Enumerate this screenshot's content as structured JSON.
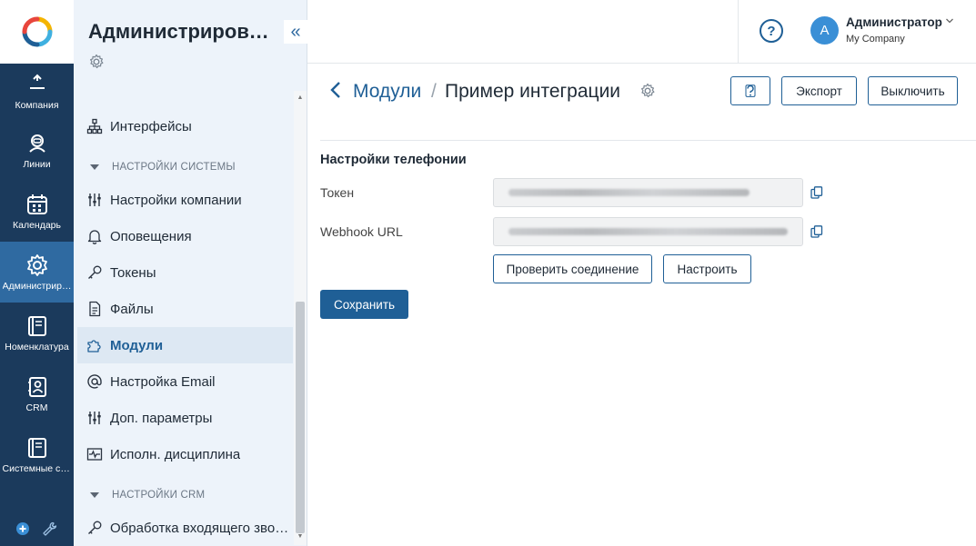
{
  "rail": {
    "items": [
      {
        "label": "Компания",
        "icon": "company-icon"
      },
      {
        "label": "Линии",
        "icon": "lines-icon"
      },
      {
        "label": "Календарь",
        "icon": "calendar-icon"
      },
      {
        "label": "Администрирование",
        "icon": "gear-icon",
        "active": true
      },
      {
        "label": "Номенклатура",
        "icon": "book-icon"
      },
      {
        "label": "CRM",
        "icon": "contacts-icon"
      },
      {
        "label": "Системные справочники",
        "icon": "book-icon"
      }
    ]
  },
  "sidebar": {
    "title": "Администрирование",
    "collapse_glyph": "«",
    "items": [
      {
        "label": "Интерфейсы",
        "icon": "hierarchy-icon"
      },
      {
        "section": "НАСТРОЙКИ СИСТЕМЫ"
      },
      {
        "label": "Настройки компании",
        "icon": "sliders-icon"
      },
      {
        "label": "Оповещения",
        "icon": "bell-icon"
      },
      {
        "label": "Токены",
        "icon": "key-icon"
      },
      {
        "label": "Файлы",
        "icon": "file-icon"
      },
      {
        "label": "Модули",
        "icon": "puzzle-icon",
        "active": true
      },
      {
        "label": "Настройка Email",
        "icon": "at-icon"
      },
      {
        "label": "Доп. параметры",
        "icon": "sliders-icon"
      },
      {
        "label": "Исполн. дисциплина",
        "icon": "pulse-icon"
      },
      {
        "section": "НАСТРОЙКИ CRM"
      },
      {
        "label": "Обработка входящего звонка",
        "icon": "key-icon"
      }
    ]
  },
  "header": {
    "help_glyph": "?",
    "user": {
      "initial": "А",
      "name": "Администратор",
      "company": "My Company"
    }
  },
  "page": {
    "back_glyph": "‹",
    "breadcrumb_parent": "Модули",
    "separator": "/",
    "title": "Пример интеграции",
    "buttons": {
      "help": "?",
      "export": "Экспорт",
      "disable": "Выключить"
    }
  },
  "form": {
    "section_title": "Настройки телефонии",
    "token_label": "Токен",
    "webhook_label": "Webhook URL",
    "check_button": "Проверить соединение",
    "configure_button": "Настроить",
    "save_button": "Сохранить"
  },
  "colors": {
    "rail": "#1b3a5c",
    "accent": "#1f5f96",
    "active_rail": "#2f6aa1",
    "sidebar_bg": "#edf3fa"
  }
}
